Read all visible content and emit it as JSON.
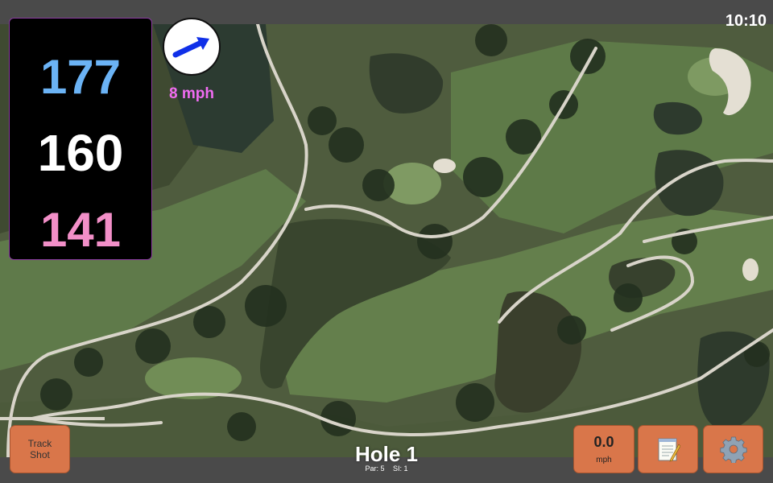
{
  "clock": "10:10",
  "distances": {
    "back": "177",
    "middle": "160",
    "front": "141"
  },
  "wind": {
    "speed_label": "8 mph",
    "direction_icon": "arrow-icon"
  },
  "buttons": {
    "track_shot_line1": "Track",
    "track_shot_line2": "Shot",
    "speed_value": "0.0",
    "speed_unit": "mph",
    "notes_icon": "notepad-icon",
    "settings_icon": "gear-icon"
  },
  "hole": {
    "title": "Hole 1",
    "par": "Par: 5",
    "si": "SI: 1"
  },
  "colors": {
    "button": "#d9764a",
    "back_distance": "#6bb3f5",
    "front_distance": "#f28fc8",
    "wind_label": "#f06cf2"
  }
}
